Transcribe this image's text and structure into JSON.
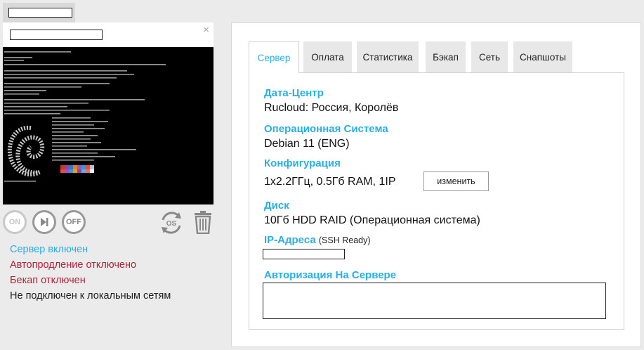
{
  "sidebar": {
    "status": {
      "server_on": "Сервер включен",
      "autorenew": "Автопродление отключено",
      "backup": "Бекап отключен",
      "local_networks": "Не подключен к локальным сетям"
    },
    "controls": {
      "on_label": "ON",
      "off_label": "OFF",
      "os_label": "OS"
    },
    "close_glyph": "×"
  },
  "tabs": [
    {
      "label": "Сервер",
      "active": true
    },
    {
      "label": "Оплата",
      "active": false
    },
    {
      "label": "Статистика",
      "active": false
    },
    {
      "label": "Бэкап",
      "active": false
    },
    {
      "label": "Сеть",
      "active": false
    },
    {
      "label": "Снапшоты",
      "active": false
    }
  ],
  "server": {
    "datacenter_title": "Дата-Центр",
    "datacenter_value": "Rucloud: Россия, Королёв",
    "os_title": "Операционная Система",
    "os_value": "Debian 11 (ENG)",
    "config_title": "Конфигурация",
    "config_value": "1x2.2ГГц, 0.5Гб RAM, 1IP",
    "change_button": "изменить",
    "disk_title": "Диск",
    "disk_value": "10Гб HDD RAID (Операционная система)",
    "ip_title": "IP-Адреса",
    "ip_note": "(SSH Ready)",
    "auth_title": "Авторизация На Сервере"
  },
  "colors": {
    "accent": "#29aee6",
    "danger": "#b0233b",
    "console_bg": "#000000"
  },
  "icons": [
    "close-icon",
    "power-on-icon",
    "play-next-icon",
    "power-off-icon",
    "reinstall-os-icon",
    "trash-icon",
    "debian-swirl-icon"
  ]
}
